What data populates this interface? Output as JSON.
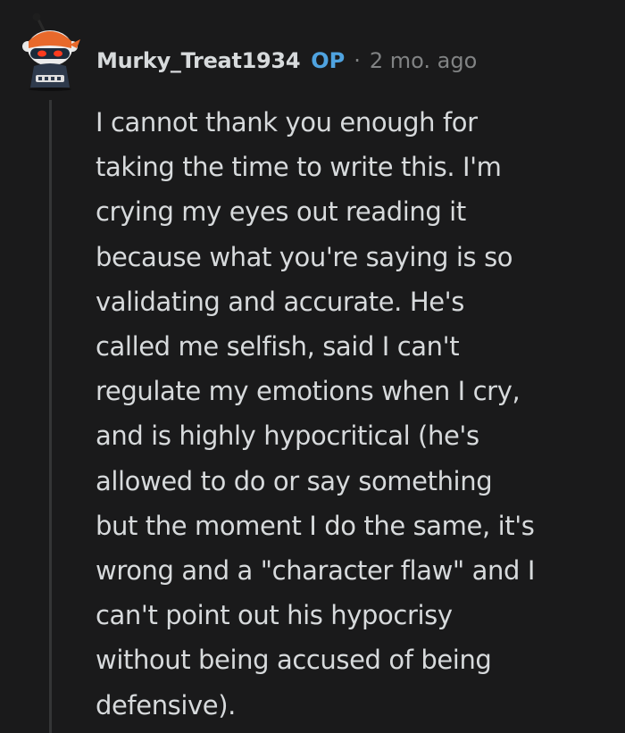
{
  "comment": {
    "username": "Murky_Treat1934",
    "op_badge": "OP",
    "separator": "·",
    "timestamp": "2 mo. ago",
    "avatar_icon": "snoo-avatar-icon",
    "body_lines": [
      "I cannot thank you enough for",
      "taking the time to write this. I'm",
      "crying my eyes out reading it",
      "because what you're saying is so",
      "validating and accurate. He's",
      "called me selfish, said I can't",
      "regulate my emotions when I cry,",
      "and is highly hypocritical (he's",
      "allowed to do or say something",
      "but the moment I do the same, it's",
      "wrong and a \"character flaw\" and I",
      "can't point out his hypocrisy",
      "without being accused of being",
      "defensive)."
    ]
  },
  "colors": {
    "background": "#1a1a1b",
    "text": "#d7dadc",
    "meta": "#818384",
    "op_accent": "#4fa3e0",
    "thread_line": "#343536"
  }
}
